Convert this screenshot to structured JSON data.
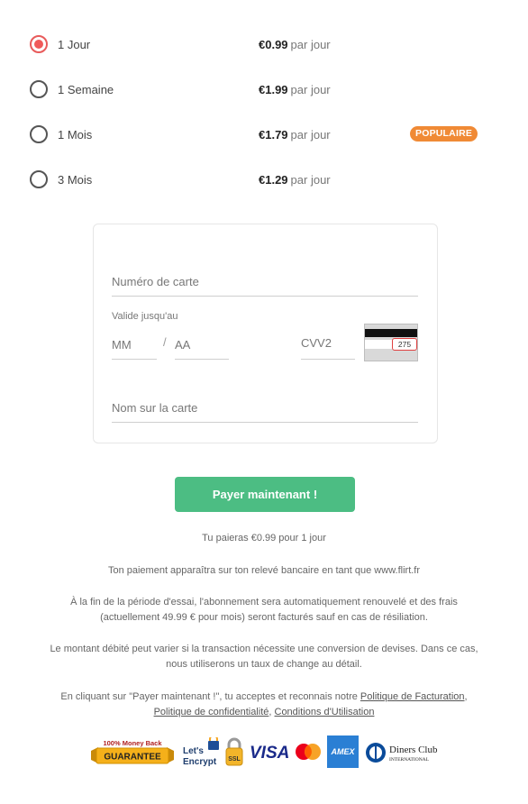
{
  "plans": [
    {
      "name": "1 Jour",
      "price": "€0.99",
      "unit": "par jour",
      "selected": true,
      "badge": ""
    },
    {
      "name": "1 Semaine",
      "price": "€1.99",
      "unit": "par jour",
      "selected": false,
      "badge": ""
    },
    {
      "name": "1 Mois",
      "price": "€1.79",
      "unit": "par jour",
      "selected": false,
      "badge": "POPULAIRE"
    },
    {
      "name": "3 Mois",
      "price": "€1.29",
      "unit": "par jour",
      "selected": false,
      "badge": ""
    }
  ],
  "form": {
    "card_number_placeholder": "Numéro de carte",
    "expiry_label": "Valide jusqu'au",
    "month_placeholder": "MM",
    "separator": "/",
    "year_placeholder": "AA",
    "cvv_placeholder": "CVV2",
    "cvv_example": "275",
    "name_placeholder": "Nom sur la carte"
  },
  "pay_button": "Payer maintenant !",
  "notes": {
    "summary": "Tu paieras €0.99 pour 1 jour",
    "statement": "Ton paiement apparaîtra sur ton relevé bancaire en tant que www.flirt.fr",
    "renewal_1": "À la fin de la période d'essai, l'abonnement sera automatiquement renouvelé et des frais",
    "renewal_2": "(actuellement 49.99 € pour mois) seront facturés sauf en cas de résiliation.",
    "currency_1": "Le montant débité peut varier si la transaction nécessite une conversion de devises. Dans ce cas,",
    "currency_2": "nous utiliserons un taux de change au détail.",
    "terms_prefix": "En cliquant sur \"Payer maintenant !\", tu acceptes et reconnais notre ",
    "billing_policy": "Politique de Facturation",
    "privacy_policy": "Politique de confidentialité",
    "terms_of_use": "Conditions d'Utilisation"
  },
  "trust": {
    "guarantee_top": "100% Money Back",
    "guarantee_main": "GUARANTEE",
    "letsencrypt_1": "Let's",
    "letsencrypt_2": "Encrypt",
    "ssl": "SSL",
    "visa": "VISA",
    "amex": "AMEX",
    "diners_1": "Diners Club",
    "diners_2": "INTERNATIONAL"
  },
  "colors": {
    "accent_radio": "#f05a5a",
    "badge": "#f08a35",
    "pay_button": "#4cbd83"
  }
}
